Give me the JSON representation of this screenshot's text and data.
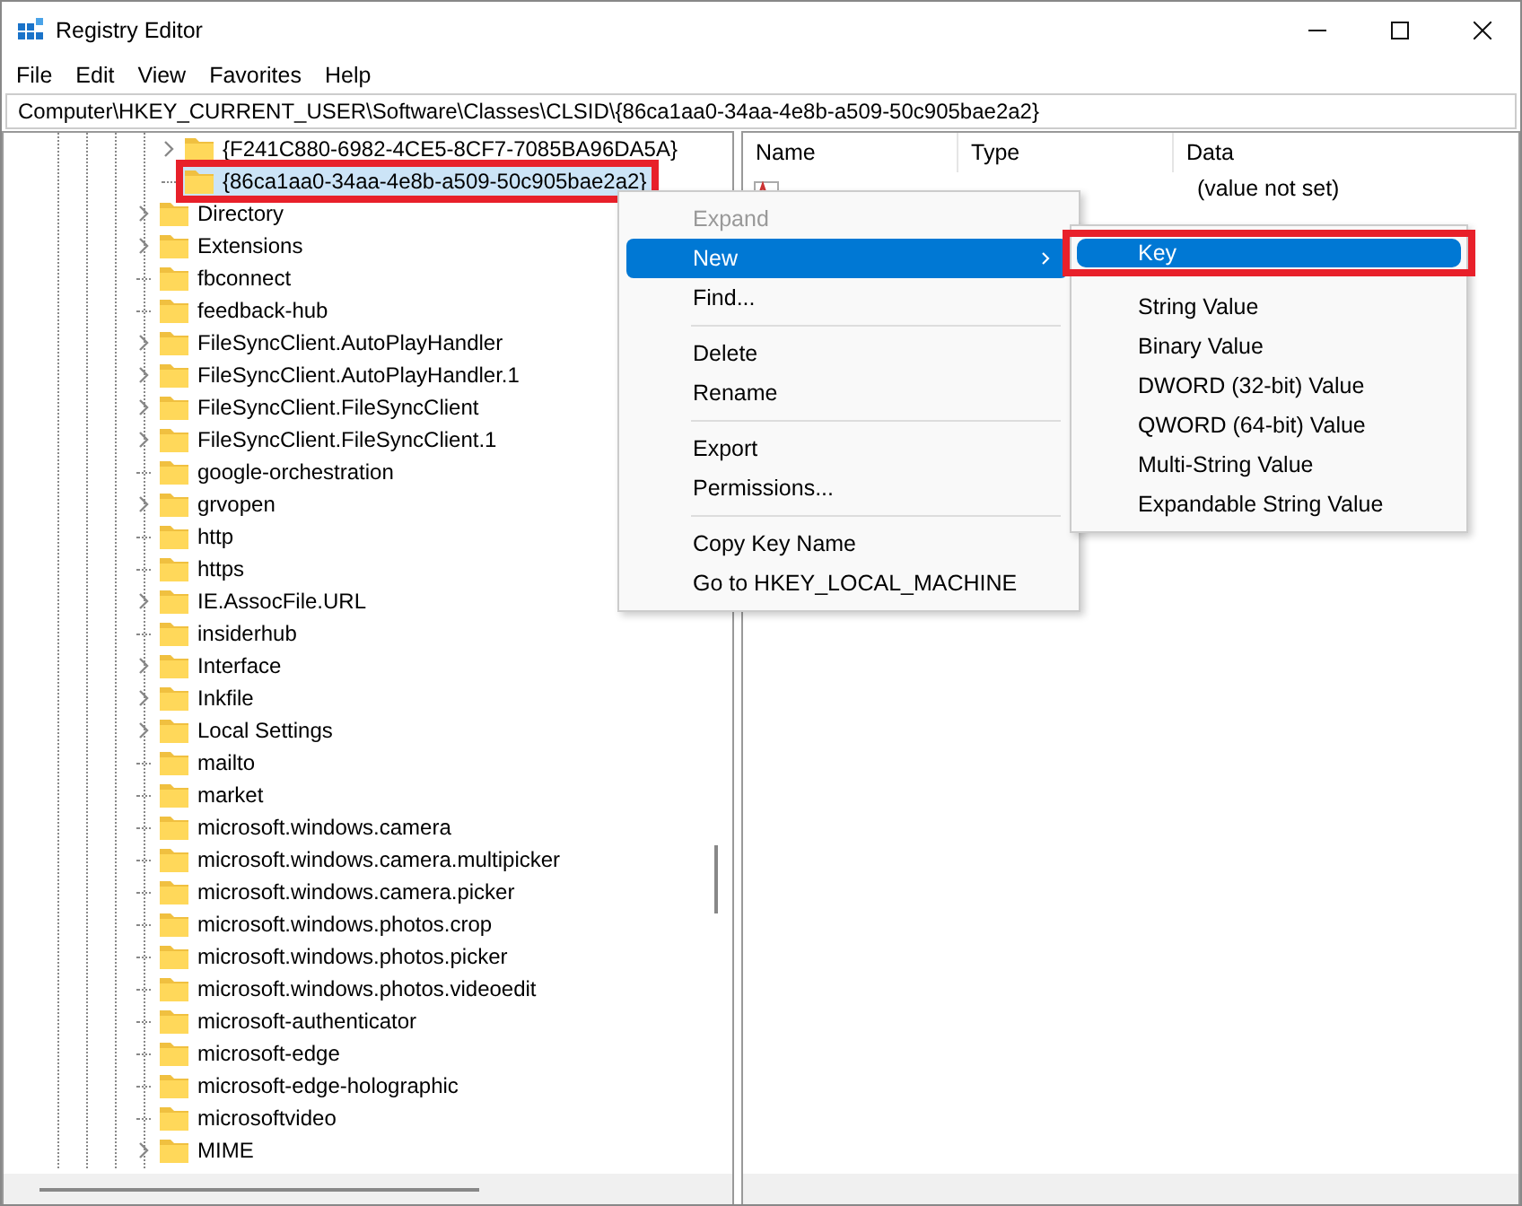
{
  "window": {
    "title": "Registry Editor"
  },
  "menu_bar": [
    "File",
    "Edit",
    "View",
    "Favorites",
    "Help"
  ],
  "address_bar": {
    "value": "Computer\\HKEY_CURRENT_USER\\Software\\Classes\\CLSID\\{86ca1aa0-34aa-4e8b-a509-50c905bae2a2}"
  },
  "tree": {
    "items": [
      {
        "kind": "continuation",
        "children": [
          {
            "label": "{F241C880-6982-4CE5-8CF7-7085BA96DA5A}",
            "expandable": true,
            "selected": false,
            "annotated": false
          },
          {
            "label": "{86ca1aa0-34aa-4e8b-a509-50c905bae2a2}",
            "expandable": false,
            "selected": true,
            "annotated": true
          }
        ]
      },
      {
        "label": "Directory",
        "expandable": true,
        "selected": false,
        "annotated": false
      },
      {
        "label": "Extensions",
        "expandable": true,
        "selected": false,
        "annotated": false
      },
      {
        "label": "fbconnect",
        "expandable": false,
        "selected": false,
        "annotated": false
      },
      {
        "label": "feedback-hub",
        "expandable": false,
        "selected": false,
        "annotated": false
      },
      {
        "label": "FileSyncClient.AutoPlayHandler",
        "expandable": true,
        "selected": false,
        "annotated": false
      },
      {
        "label": "FileSyncClient.AutoPlayHandler.1",
        "expandable": true,
        "selected": false,
        "annotated": false
      },
      {
        "label": "FileSyncClient.FileSyncClient",
        "expandable": true,
        "selected": false,
        "annotated": false
      },
      {
        "label": "FileSyncClient.FileSyncClient.1",
        "expandable": true,
        "selected": false,
        "annotated": false
      },
      {
        "label": "google-orchestration",
        "expandable": false,
        "selected": false,
        "annotated": false
      },
      {
        "label": "grvopen",
        "expandable": true,
        "selected": false,
        "annotated": false
      },
      {
        "label": "http",
        "expandable": false,
        "selected": false,
        "annotated": false
      },
      {
        "label": "https",
        "expandable": false,
        "selected": false,
        "annotated": false
      },
      {
        "label": "IE.AssocFile.URL",
        "expandable": true,
        "selected": false,
        "annotated": false
      },
      {
        "label": "insiderhub",
        "expandable": false,
        "selected": false,
        "annotated": false
      },
      {
        "label": "Interface",
        "expandable": true,
        "selected": false,
        "annotated": false
      },
      {
        "label": "Inkfile",
        "expandable": true,
        "selected": false,
        "annotated": false
      },
      {
        "label": "Local Settings",
        "expandable": true,
        "selected": false,
        "annotated": false
      },
      {
        "label": "mailto",
        "expandable": false,
        "selected": false,
        "annotated": false
      },
      {
        "label": "market",
        "expandable": false,
        "selected": false,
        "annotated": false
      },
      {
        "label": "microsoft.windows.camera",
        "expandable": false,
        "selected": false,
        "annotated": false
      },
      {
        "label": "microsoft.windows.camera.multipicker",
        "expandable": false,
        "selected": false,
        "annotated": false
      },
      {
        "label": "microsoft.windows.camera.picker",
        "expandable": false,
        "selected": false,
        "annotated": false
      },
      {
        "label": "microsoft.windows.photos.crop",
        "expandable": false,
        "selected": false,
        "annotated": false
      },
      {
        "label": "microsoft.windows.photos.picker",
        "expandable": false,
        "selected": false,
        "annotated": false
      },
      {
        "label": "microsoft.windows.photos.videoedit",
        "expandable": false,
        "selected": false,
        "annotated": false
      },
      {
        "label": "microsoft-authenticator",
        "expandable": false,
        "selected": false,
        "annotated": false
      },
      {
        "label": "microsoft-edge",
        "expandable": false,
        "selected": false,
        "annotated": false
      },
      {
        "label": "microsoft-edge-holographic",
        "expandable": false,
        "selected": false,
        "annotated": false
      },
      {
        "label": "microsoftvideo",
        "expandable": false,
        "selected": false,
        "annotated": false
      },
      {
        "label": "MIME",
        "expandable": true,
        "selected": false,
        "annotated": false
      }
    ]
  },
  "values_list": {
    "columns": [
      "Name",
      "Type",
      "Data"
    ],
    "rows": [
      {
        "data": "(value not set)"
      }
    ]
  },
  "context_menu": {
    "items": [
      {
        "kind": "item",
        "label": "Expand",
        "disabled": true,
        "selected": false,
        "submenu": false
      },
      {
        "kind": "item",
        "label": "New",
        "disabled": false,
        "selected": true,
        "submenu": true
      },
      {
        "kind": "item",
        "label": "Find...",
        "disabled": false,
        "selected": false,
        "submenu": false
      },
      {
        "kind": "separator"
      },
      {
        "kind": "item",
        "label": "Delete",
        "disabled": false,
        "selected": false,
        "submenu": false
      },
      {
        "kind": "item",
        "label": "Rename",
        "disabled": false,
        "selected": false,
        "submenu": false
      },
      {
        "kind": "separator"
      },
      {
        "kind": "item",
        "label": "Export",
        "disabled": false,
        "selected": false,
        "submenu": false
      },
      {
        "kind": "item",
        "label": "Permissions...",
        "disabled": false,
        "selected": false,
        "submenu": false
      },
      {
        "kind": "separator"
      },
      {
        "kind": "item",
        "label": "Copy Key Name",
        "disabled": false,
        "selected": false,
        "submenu": false
      },
      {
        "kind": "item",
        "label": "Go to HKEY_LOCAL_MACHINE",
        "disabled": false,
        "selected": false,
        "submenu": false
      }
    ]
  },
  "submenu": {
    "items": [
      {
        "kind": "item",
        "label": "Key",
        "selected": true,
        "annotated": true
      },
      {
        "kind": "separator"
      },
      {
        "kind": "item",
        "label": "String Value",
        "selected": false,
        "annotated": false
      },
      {
        "kind": "item",
        "label": "Binary Value",
        "selected": false,
        "annotated": false
      },
      {
        "kind": "item",
        "label": "DWORD (32-bit) Value",
        "selected": false,
        "annotated": false
      },
      {
        "kind": "item",
        "label": "QWORD (64-bit) Value",
        "selected": false,
        "annotated": false
      },
      {
        "kind": "item",
        "label": "Multi-String Value",
        "selected": false,
        "annotated": false
      },
      {
        "kind": "item",
        "label": "Expandable String Value",
        "selected": false,
        "annotated": false
      }
    ]
  }
}
